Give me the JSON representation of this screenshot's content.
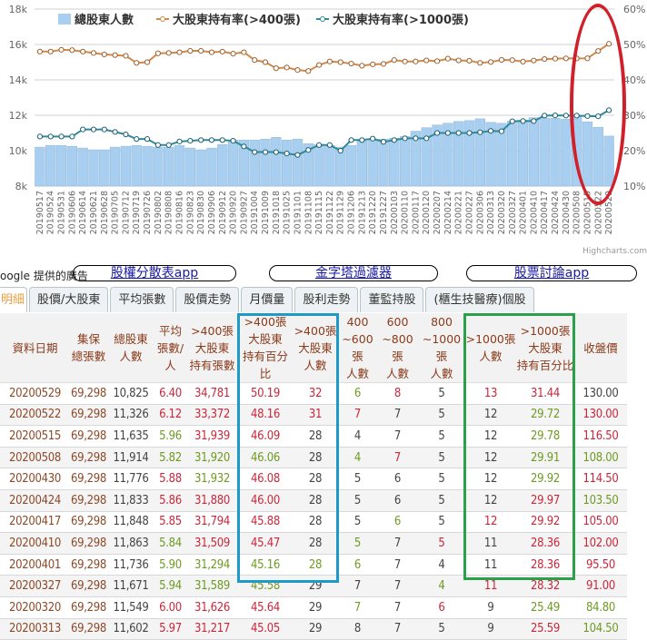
{
  "chart_data": {
    "type": "bar+line",
    "legend": [
      "總股東人數",
      "大股東持有率(>400張)",
      "大股東持有率(>1000張)"
    ],
    "y_left": {
      "ticks": [
        "8k",
        "10k",
        "12k",
        "14k",
        "16k",
        "18k"
      ],
      "range": [
        8000,
        18000
      ]
    },
    "y_right": {
      "ticks": [
        "10%",
        "20%",
        "30%",
        "40%",
        "50%",
        "60%"
      ],
      "range": [
        10,
        60
      ]
    },
    "credit": "Highcharts.com",
    "x": [
      "20190517",
      "20190524",
      "20190531",
      "20190606",
      "20190614",
      "20190621",
      "20190628",
      "20190705",
      "20190712",
      "20190719",
      "20190726",
      "20190802",
      "20190808",
      "20190816",
      "20190823",
      "20190830",
      "20190906",
      "20190912",
      "20190920",
      "20190927",
      "20191004",
      "20191009",
      "20191018",
      "20191025",
      "20191101",
      "20191108",
      "20191115",
      "20191122",
      "20191129",
      "20191206",
      "20191213",
      "20191220",
      "20191227",
      "20200103",
      "20200110",
      "20200117",
      "20200120",
      "20200207",
      "20200214",
      "20200221",
      "20200227",
      "20200306",
      "20200313",
      "20200320",
      "20200327",
      "20200401",
      "20200410",
      "20200417",
      "20200424",
      "20200430",
      "20200508",
      "20200515",
      "20200522",
      "20200529"
    ],
    "series": [
      {
        "name": "總股東人數",
        "type": "bar",
        "color": "#a9cff0",
        "values": [
          10200,
          10300,
          10300,
          10250,
          10150,
          10050,
          10050,
          10200,
          10250,
          10300,
          10250,
          10200,
          10200,
          10300,
          10150,
          10050,
          10150,
          10350,
          10600,
          10600,
          10600,
          10650,
          10750,
          10600,
          10650,
          10400,
          10350,
          10300,
          10200,
          10300,
          10550,
          10650,
          10650,
          10700,
          10800,
          11100,
          11300,
          11450,
          11550,
          11650,
          11700,
          11800,
          11602,
          11549,
          11671,
          11736,
          11863,
          11848,
          11833,
          11776,
          11914,
          11635,
          11326,
          10825
        ]
      },
      {
        "name": "大股東持有率(>400張)",
        "type": "line",
        "color": "#d08a4a",
        "values": [
          48.0,
          48.0,
          48.5,
          48.4,
          48.0,
          47.6,
          47.2,
          47.0,
          46.8,
          44.8,
          45.0,
          47.5,
          47.6,
          47.8,
          48.2,
          48.2,
          47.8,
          48.0,
          47.4,
          47.8,
          45.6,
          45.0,
          43.3,
          43.5,
          42.8,
          42.5,
          44.2,
          45.2,
          45.0,
          44.6,
          44.0,
          44.4,
          44.5,
          45.6,
          45.2,
          45.2,
          45.5,
          45.3,
          46.0,
          45.5,
          45.4,
          44.8,
          45.05,
          45.64,
          45.58,
          45.16,
          45.47,
          45.88,
          46.0,
          46.08,
          46.06,
          46.09,
          48.16,
          50.19
        ]
      },
      {
        "name": "大股東持有率(>1000張)",
        "type": "line",
        "color": "#2e8a9a",
        "values": [
          24.0,
          24.0,
          24.0,
          24.0,
          26.0,
          26.0,
          26.0,
          25.3,
          24.6,
          23.3,
          23.3,
          21.6,
          21.6,
          22.6,
          22.8,
          23.0,
          23.0,
          23.0,
          22.8,
          21.2,
          19.6,
          19.6,
          19.6,
          19.2,
          18.8,
          20.2,
          21.6,
          21.6,
          20.0,
          23.0,
          23.0,
          23.4,
          22.5,
          23.0,
          23.5,
          23.5,
          23.5,
          25.0,
          25.0,
          25.0,
          25.0,
          25.2,
          25.59,
          25.49,
          28.32,
          28.36,
          28.36,
          29.92,
          29.97,
          29.92,
          29.91,
          29.78,
          29.72,
          31.44
        ]
      }
    ]
  },
  "ad": {
    "label": "oogle 提供的廣告",
    "links": [
      "股權分散表app",
      "金字塔過濾器",
      "股票討論app"
    ]
  },
  "tabs": [
    "明細",
    "股價/大股東",
    "平均張數",
    "股價走勢",
    "月價量",
    "股利走勢",
    "董監持股",
    "(櫃生技醫療)個股"
  ],
  "table": {
    "headers": [
      [
        "資料日期"
      ],
      [
        "集保",
        "總張數"
      ],
      [
        "總股東",
        "人數"
      ],
      [
        "平均",
        "張數/人"
      ],
      [
        ">400張",
        "大股東",
        "持有張數"
      ],
      [
        ">400張",
        "大股東",
        "持有百分比"
      ],
      [
        ">400張",
        "大股東",
        "人數"
      ],
      [
        "400",
        "~600張",
        "人數"
      ],
      [
        "600",
        "~800張",
        "人數"
      ],
      [
        "800",
        "~1000張",
        "人數"
      ],
      [
        ">1000張",
        "人數"
      ],
      [
        ">1000張",
        "大股東",
        "持有百分比"
      ],
      [
        "收盤價"
      ]
    ],
    "rows": [
      {
        "v": [
          "20200529",
          "69,298",
          "10,825",
          "6.40",
          "34,781",
          "50.19",
          "32",
          "6",
          "8",
          "5",
          "13",
          "31.44",
          "130.00"
        ],
        "c": "bbnrrrrgrnrrn"
      },
      {
        "v": [
          "20200522",
          "69,298",
          "11,326",
          "6.12",
          "33,372",
          "48.16",
          "31",
          "7",
          "7",
          "5",
          "12",
          "29.72",
          "130.00"
        ],
        "c": "bbnrrrrrnnngr"
      },
      {
        "v": [
          "20200515",
          "69,298",
          "11,635",
          "5.96",
          "31,939",
          "46.09",
          "28",
          "4",
          "7",
          "5",
          "12",
          "29.78",
          "116.50"
        ],
        "c": "bbngrrnnnnngr"
      },
      {
        "v": [
          "20200508",
          "69,298",
          "11,914",
          "5.82",
          "31,920",
          "46.06",
          "28",
          "4",
          "7",
          "5",
          "12",
          "29.91",
          "108.00"
        ],
        "c": "bbngggngrnngg"
      },
      {
        "v": [
          "20200430",
          "69,298",
          "11,776",
          "5.88",
          "31,932",
          "46.08",
          "28",
          "5",
          "6",
          "5",
          "12",
          "29.92",
          "114.50"
        ],
        "c": "bbnrgrnnnnngr"
      },
      {
        "v": [
          "20200424",
          "69,298",
          "11,833",
          "5.86",
          "31,880",
          "46.00",
          "28",
          "5",
          "6",
          "5",
          "12",
          "29.97",
          "103.50"
        ],
        "c": "bbnrrrnnnnnrg"
      },
      {
        "v": [
          "20200417",
          "69,298",
          "11,848",
          "5.85",
          "31,794",
          "45.88",
          "28",
          "5",
          "6",
          "5",
          "12",
          "29.92",
          "105.00"
        ],
        "c": "bbnrrrnngnrrr"
      },
      {
        "v": [
          "20200410",
          "69,298",
          "11,863",
          "5.84",
          "31,509",
          "45.47",
          "28",
          "5",
          "7",
          "5",
          "11",
          "28.36",
          "102.00"
        ],
        "c": "bbngrrngnrnrr"
      },
      {
        "v": [
          "20200401",
          "69,298",
          "11,736",
          "5.90",
          "31,294",
          "45.16",
          "28",
          "6",
          "7",
          "4",
          "11",
          "28.36",
          "95.50"
        ],
        "c": "bbngggggnnnrr"
      },
      {
        "v": [
          "20200327",
          "69,298",
          "11,671",
          "5.94",
          "31,589",
          "45.58",
          "29",
          "7",
          "7",
          "4",
          "11",
          "28.32",
          "91.00"
        ],
        "c": "bbngggnnngrrr"
      },
      {
        "v": [
          "20200320",
          "69,298",
          "11,549",
          "6.00",
          "31,626",
          "45.64",
          "29",
          "7",
          "7",
          "6",
          "9",
          "25.49",
          "84.80"
        ],
        "c": "bbnrrrngnrngg"
      },
      {
        "v": [
          "20200313",
          "69,298",
          "11,602",
          "5.97",
          "31,217",
          "45.05",
          "29",
          "8",
          "7",
          "5",
          "9",
          "25.59",
          "104.50"
        ],
        "c": "bbnrrrnnnnnrg"
      }
    ]
  },
  "colors": {
    "red": "#c8283c",
    "green": "#6f9a24",
    "highlight_blue": "#1e9ac8",
    "highlight_green": "#2aa04a",
    "annotation_red": "#d0202a"
  }
}
